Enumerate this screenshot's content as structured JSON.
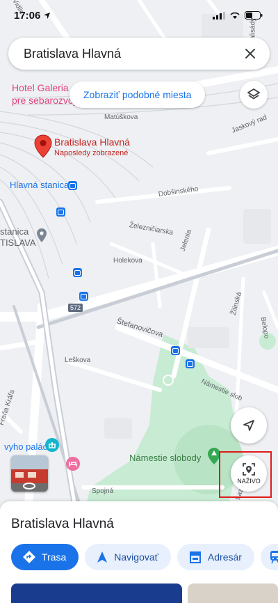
{
  "status": {
    "time": "17:06"
  },
  "search": {
    "query": "Bratislava Hlavná"
  },
  "map": {
    "similar_places_button": "Zobraziť podobné miesta",
    "hotel_label_line1": "Hotel Galeria",
    "hotel_label_line2": "pre sebarozvoj",
    "pin_title": "Bratislava Hlavná",
    "pin_subtitle": "Naposledy zobrazené",
    "station_label": "Hlavná stanica",
    "station2_line1": "stanica",
    "station2_line2": "TISLAVA",
    "road_shield": "572",
    "park_label": "Námestie slobody",
    "palace_label": "vyho palác",
    "live_label": "NAŽIVO",
    "streets": {
      "vidlicova": "Vidlic",
      "matuskova": "Matúškova",
      "jaskovy": "Jaskový rad",
      "dobsinskeho": "Dobšinského",
      "zeleznicna": "Železničiarska",
      "jelenia": "Jelenia",
      "holekova": "Holekova",
      "zilinska": "Žilinská",
      "belopot": "Belopo",
      "stefanovicova": "Štefanovičova",
      "leskova": "Leškova",
      "namestie_slob": "Námestie slob",
      "frana_krala": "Fraňa Kráľa",
      "spojna": "Spojná",
      "lazaretska": "Lazaret",
      "palisady": "Palisády"
    }
  },
  "sheet": {
    "title": "Bratislava Hlavná",
    "actions": [
      {
        "label": "Trasa"
      },
      {
        "label": "Navigovať"
      },
      {
        "label": "Adresár"
      }
    ]
  },
  "colors": {
    "accent": "#1a73e8",
    "pin": "#ea4335",
    "park": "#c8ecd3",
    "highlight": "#e01b1b"
  }
}
